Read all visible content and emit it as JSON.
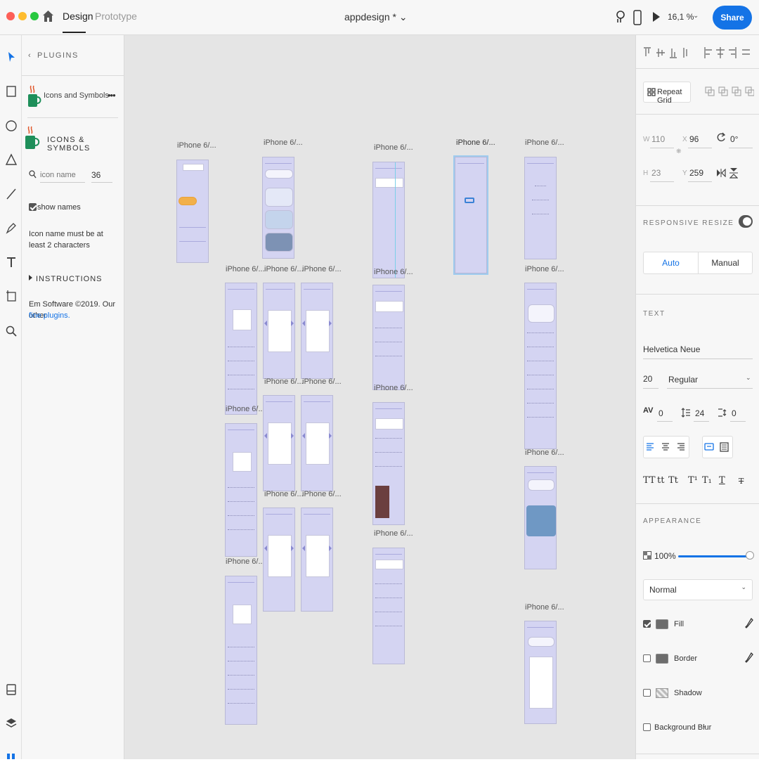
{
  "titlebar": {
    "tabs": [
      "Design",
      "Prototype"
    ],
    "doc_title": "appdesign * ⌄",
    "zoom": "16,1 %",
    "share_label": "Share"
  },
  "toolbar": {
    "tools": [
      "select-tool-icon",
      "rectangle-tool-icon",
      "ellipse-tool-icon",
      "polygon-tool-icon",
      "line-tool-icon",
      "pen-tool-icon",
      "text-tool-icon",
      "artboard-tool-icon",
      "zoom-tool-icon",
      "assets-icon",
      "layers-icon",
      "plugins-icon"
    ]
  },
  "plugins": {
    "header": "PLUGINS",
    "plugin_name": "Icons and Symbols",
    "more": "•••",
    "panel_title": "ICONS & SYMBOLS",
    "search_placeholder": "icon name",
    "size_value": "36",
    "show_names_label": "show names",
    "error_message": "Icon name must be at least 2 characters",
    "instructions_label": "INSTRUCTIONS",
    "footer_text": "Em Software ©2019. Our other",
    "footer_link": "fine plugins."
  },
  "canvas": {
    "artboard_label": "iPhone 6/..."
  },
  "properties": {
    "repeat_grid_label": "Repeat Grid",
    "w_label": "W",
    "w_value": "110",
    "h_label": "H",
    "h_value": "23",
    "x_label": "X",
    "x_value": "96",
    "y_label": "Y",
    "y_value": "259",
    "rotation_value": "0°",
    "responsive_label": "RESPONSIVE RESIZE",
    "responsive_on": true,
    "auto_label": "Auto",
    "manual_label": "Manual",
    "text_label": "TEXT",
    "font_family": "Helvetica Neue",
    "font_size": "20",
    "font_weight": "Regular",
    "char_spacing": "0",
    "line_spacing": "24",
    "para_spacing": "0",
    "case_options": [
      "TT",
      "tt",
      "Tt",
      "T¹",
      "T₁",
      "T",
      "T"
    ],
    "appearance_label": "APPEARANCE",
    "opacity_value": "100%",
    "opacity_level": 1.0,
    "blend_mode": "Normal",
    "fill_label": "Fill",
    "fill_checked": true,
    "border_label": "Border",
    "border_checked": false,
    "shadow_label": "Shadow",
    "shadow_checked": false,
    "blur_label": "Background Blur",
    "blur_checked": false,
    "colors": {
      "accent": "#1473e6",
      "artboard_fill": "#d4d4f2",
      "swatch": "#6d6d6d"
    }
  }
}
